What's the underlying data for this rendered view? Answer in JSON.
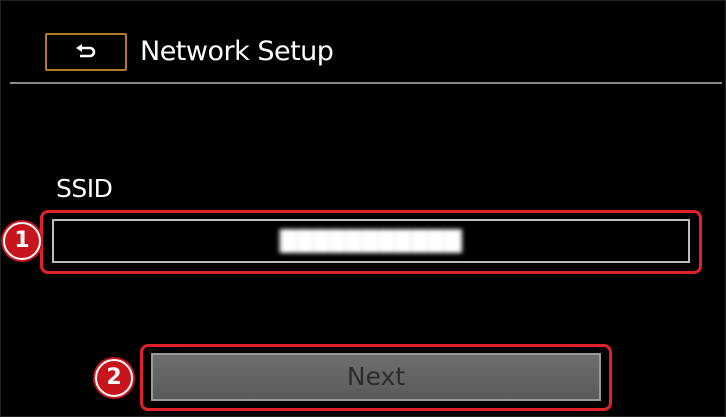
{
  "header": {
    "back_icon": "back-arrow-icon",
    "title": "Network Setup"
  },
  "ssid": {
    "label": "SSID",
    "value": "███████████"
  },
  "next_button": {
    "label": "Next"
  },
  "callouts": {
    "first": "1",
    "second": "2"
  },
  "colors": {
    "background": "#000000",
    "back_button_border": "#b5792a",
    "highlight_red": "#e0202a",
    "divider": "#8a8a8a",
    "next_button_fill": "#666666"
  }
}
